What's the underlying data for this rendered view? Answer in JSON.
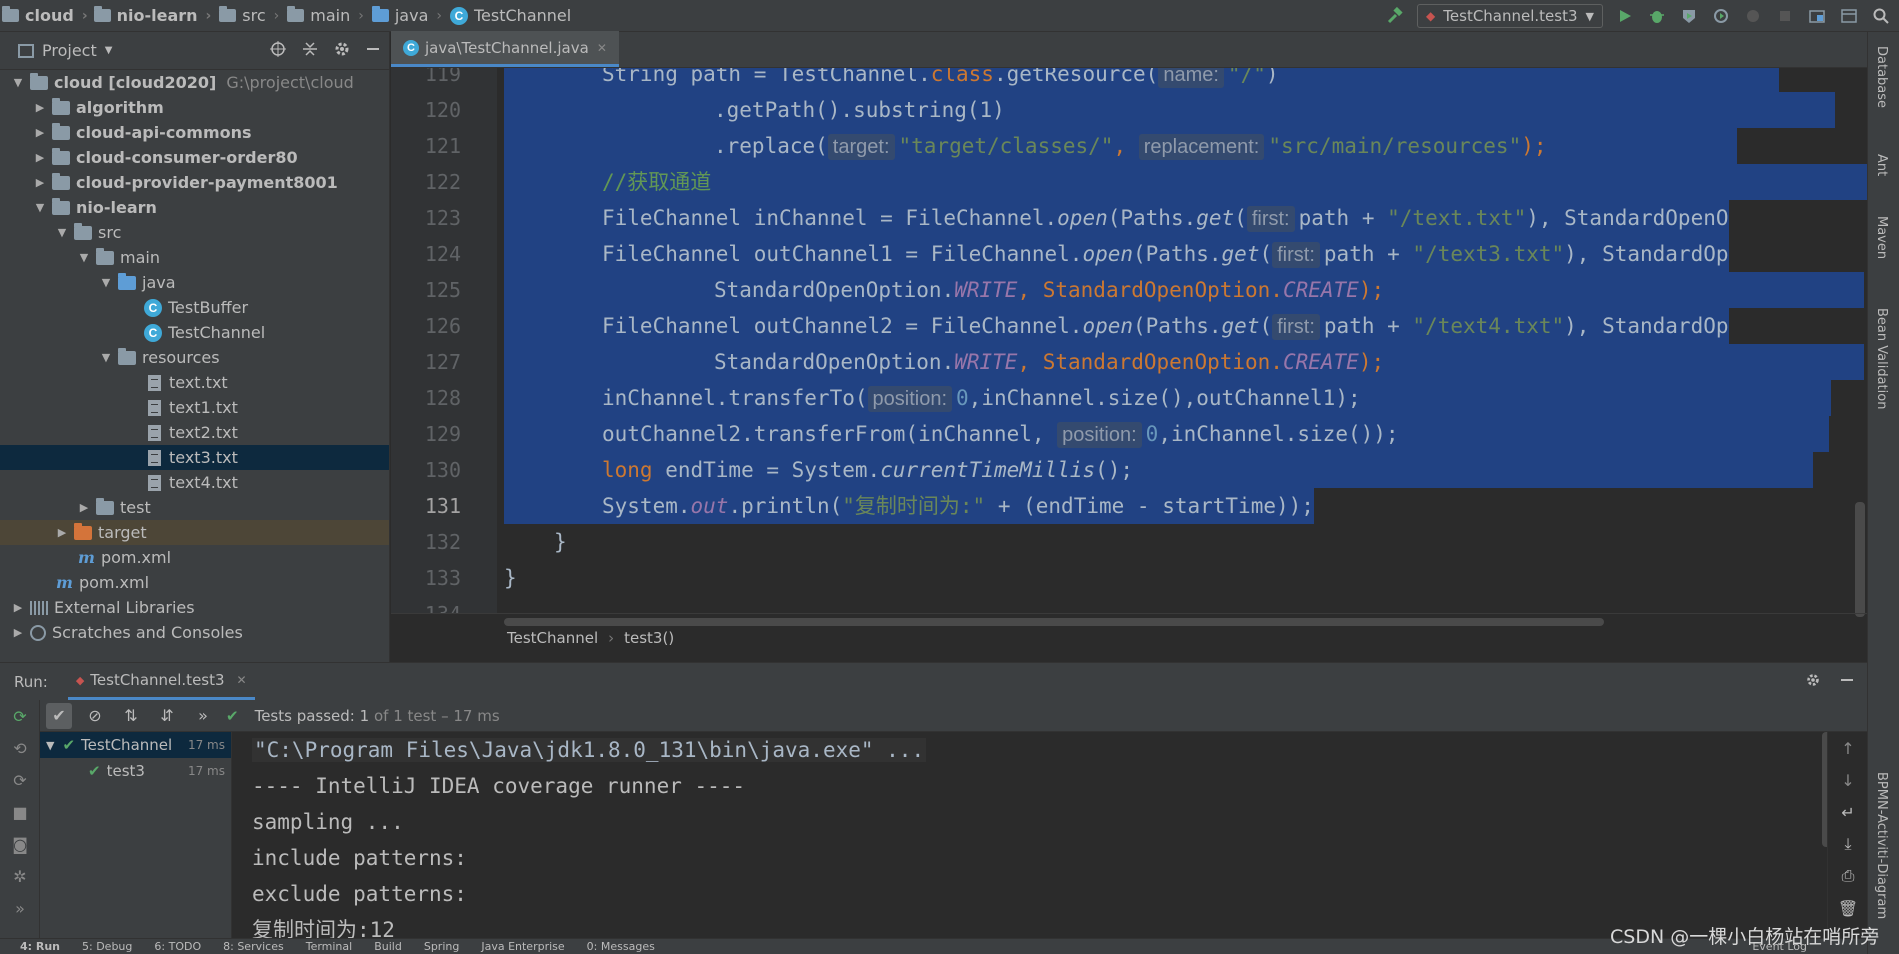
{
  "navbar": {
    "crumbs": [
      "cloud",
      "nio-learn",
      "src",
      "main",
      "java",
      "TestChannel"
    ],
    "run_config": "TestChannel.test3"
  },
  "project": {
    "title": "Project",
    "tree": [
      {
        "label": "cloud [cloud2020]",
        "extra": "G:\\project\\cloud"
      },
      {
        "label": "algorithm"
      },
      {
        "label": "cloud-api-commons"
      },
      {
        "label": "cloud-consumer-order80"
      },
      {
        "label": "cloud-provider-payment8001"
      },
      {
        "label": "nio-learn"
      },
      {
        "label": "src"
      },
      {
        "label": "main"
      },
      {
        "label": "java"
      },
      {
        "label": "TestBuffer"
      },
      {
        "label": "TestChannel"
      },
      {
        "label": "resources"
      },
      {
        "label": "text.txt"
      },
      {
        "label": "text1.txt"
      },
      {
        "label": "text2.txt"
      },
      {
        "label": "text3.txt"
      },
      {
        "label": "text4.txt"
      },
      {
        "label": "test"
      },
      {
        "label": "target"
      },
      {
        "label": "pom.xml"
      },
      {
        "label": "pom.xml"
      },
      {
        "label": "External Libraries"
      },
      {
        "label": "Scratches and Consoles"
      }
    ]
  },
  "editor": {
    "tab": "java\\TestChannel.java",
    "line_numbers": [
      "119",
      "120",
      "121",
      "122",
      "123",
      "124",
      "125",
      "126",
      "127",
      "128",
      "129",
      "130",
      "131",
      "132",
      "133",
      "134"
    ],
    "code": {
      "l119": {
        "a": "String path = TestChannel.",
        "k": "class",
        "b": ".getResource(",
        "hint": "name:",
        "s": "\"/\"",
        "c": ")"
      },
      "l120": ".getPath().substring(1)",
      "l121": {
        "a": ".replace(",
        "h1": "target:",
        "s1": "\"target/classes/\"",
        "m": ", ",
        "h2": "replacement:",
        "s2": "\"src/main/resources\"",
        "c": ");"
      },
      "l122": "//获取通道",
      "l123": {
        "a": "FileChannel inChannel = FileChannel.",
        "open": "open",
        "b": "(Paths.",
        "get": "get",
        "c": "(",
        "hint": "first:",
        "d": "path + ",
        "s": "\"/text.txt\"",
        "e": "), StandardOpenO"
      },
      "l124": {
        "a": "FileChannel outChannel1 = FileChannel.",
        "open": "open",
        "b": "(Paths.",
        "get": "get",
        "c": "(",
        "hint": "first:",
        "d": "path + ",
        "s": "\"/text3.txt\"",
        "e": "), StandardOp"
      },
      "l125": {
        "a": "StandardOpenOption.",
        "w": "WRITE",
        "b": ", StandardOpenOption.",
        "cr": "CREATE",
        "c": ");"
      },
      "l126": {
        "a": "FileChannel outChannel2 = FileChannel.",
        "open": "open",
        "b": "(Paths.",
        "get": "get",
        "c": "(",
        "hint": "first:",
        "d": "path + ",
        "s": "\"/text4.txt\"",
        "e": "), StandardOp"
      },
      "l127": {
        "a": "StandardOpenOption.",
        "w": "WRITE",
        "b": ", StandardOpenOption.",
        "cr": "CREATE",
        "c": ");"
      },
      "l128": {
        "a": "inChannel.transferTo(",
        "hint": "position:",
        "n": "0",
        "b": ",inChannel.size(),outChannel1);"
      },
      "l129": {
        "a": "outChannel2.transferFrom(inChannel, ",
        "hint": "position:",
        "n": "0",
        "b": ",inChannel.size());"
      },
      "l130": {
        "k": "long",
        "a": " endTime = System.",
        "m": "currentTimeMillis",
        "b": "();"
      },
      "l131": {
        "a": "System.",
        "out": "out",
        "b": ".println(",
        "s": "\"复制时间为:\"",
        "c": " + (endTime - startTime));"
      },
      "l132": "}",
      "l133": "}"
    },
    "breadcrumb": [
      "TestChannel",
      "test3()"
    ]
  },
  "run": {
    "label": "Run:",
    "tab": "TestChannel.test3",
    "status_prefix": "Tests passed:",
    "status_count": "1",
    "status_rest": "of 1 test – 17 ms",
    "tests": [
      {
        "name": "TestChannel",
        "time": "17 ms"
      },
      {
        "name": "test3",
        "time": "17 ms"
      }
    ],
    "console": [
      "\"C:\\Program Files\\Java\\jdk1.8.0_131\\bin\\java.exe\" ...",
      "---- IntelliJ IDEA coverage runner ----",
      "sampling ...",
      "include patterns:",
      "exclude patterns:",
      "复制时间为:12"
    ]
  },
  "right_tools": [
    "Database",
    "Ant",
    "Maven",
    "Bean Validation",
    "BPMN-Activiti-Diagram"
  ],
  "bottom_tools": [
    "4: Run",
    "5: Debug",
    "6: TODO",
    "8: Services",
    "Terminal",
    "Build",
    "Spring",
    "Java Enterprise",
    "0: Messages",
    "Event Log"
  ],
  "watermark": "CSDN @一棵小白杨站在哨所旁",
  "colors": {
    "selection": "#214283",
    "keyword": "#cc7832",
    "string": "#6a8759",
    "static": "#9876aa",
    "pass": "#59a869"
  }
}
